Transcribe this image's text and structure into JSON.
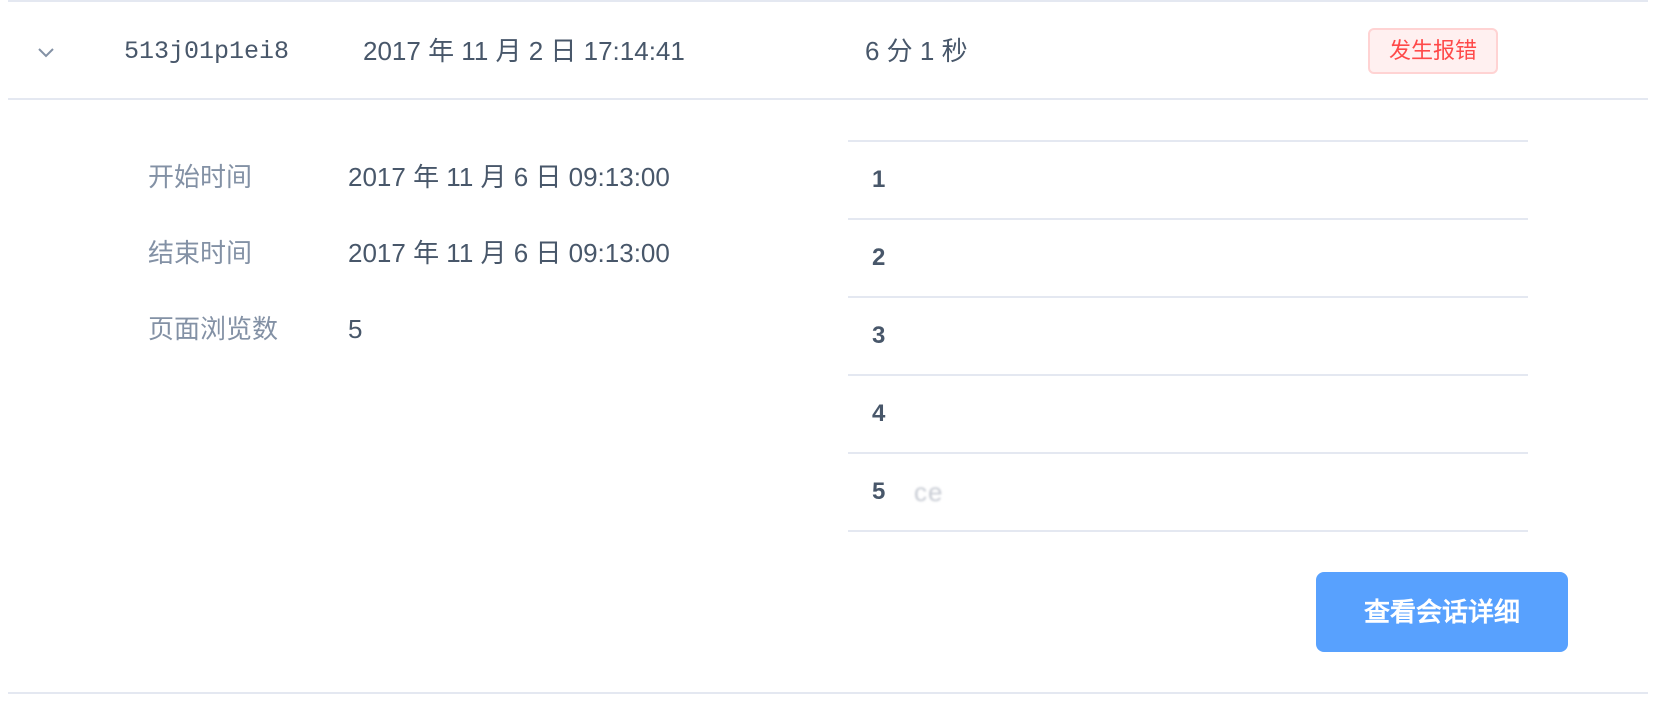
{
  "session": {
    "id": "513j01p1ei8",
    "time": "2017 年 11 月 2 日 17:14:41",
    "duration": "6 分 1 秒",
    "status": "发生报错"
  },
  "details": {
    "start_label": "开始时间",
    "start_value": "2017 年 11 月 6 日 09:13:00",
    "end_label": "结束时间",
    "end_value": "2017 年 11 月 6 日 09:13:00",
    "views_label": "页面浏览数",
    "views_value": "5"
  },
  "pages": [
    {
      "num": "1",
      "url": ""
    },
    {
      "num": "2",
      "url": ""
    },
    {
      "num": "3",
      "url": ""
    },
    {
      "num": "4",
      "url": ""
    },
    {
      "num": "5",
      "url": "ce"
    }
  ],
  "actions": {
    "view_detail_label": "查看会话详细"
  },
  "colors": {
    "primary": "#58a1fe",
    "error": "#ff4949",
    "label": "#8391a5",
    "text": "#48576a",
    "border": "#e4e8f1"
  },
  "icons": {
    "expand": "chevron-down-icon"
  }
}
